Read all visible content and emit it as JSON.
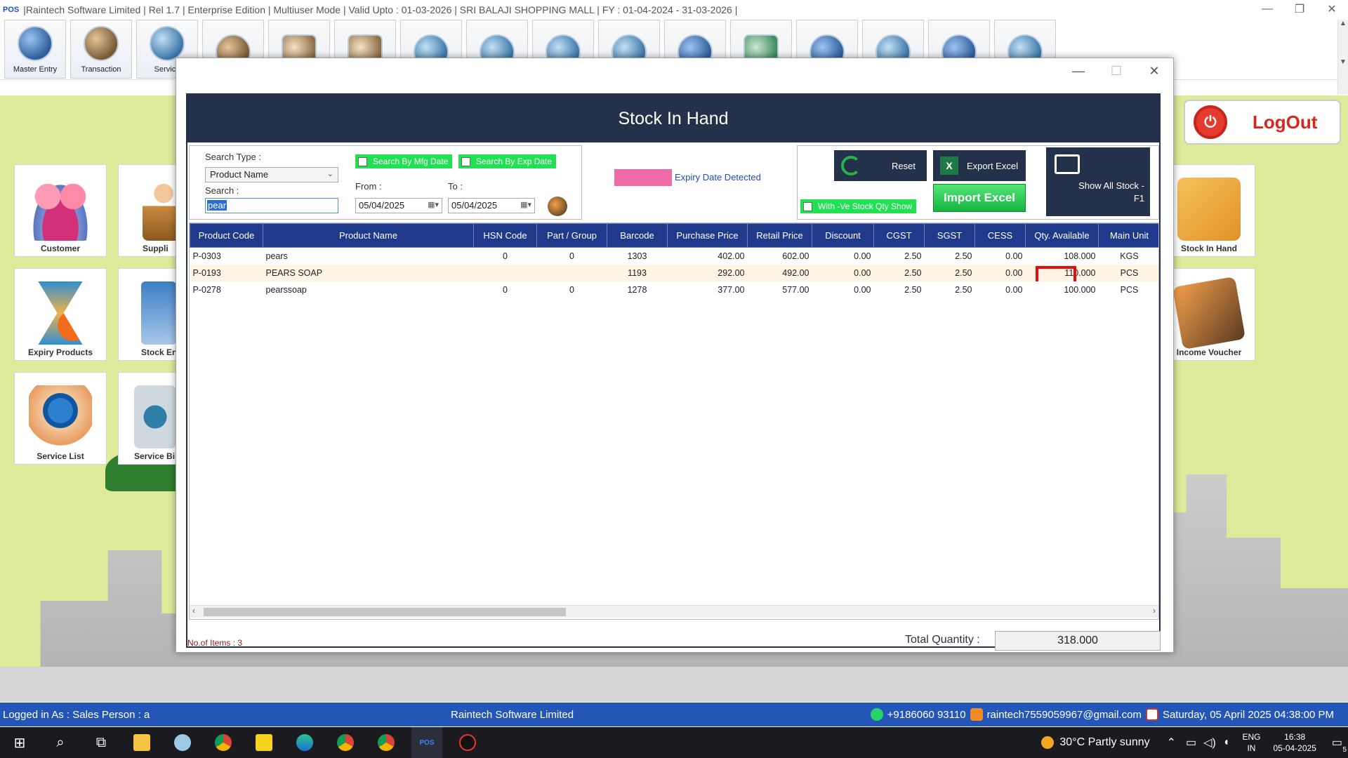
{
  "app": {
    "logo": "POS",
    "title": "|Raintech Software Limited |  Rel 1.7  |  Enterprise Edition  |  Multiuser Mode  |  Valid Upto : 01-03-2026  |  SRI BALAJI SHOPPING MALL  |  FY : 01-04-2024  -  31-03-2026  |",
    "win_minimize": "—",
    "win_restore": "❐",
    "win_close": "✕"
  },
  "toolbar": {
    "buttons": [
      {
        "label": "Master Entry",
        "icon": "master-entry-icon"
      },
      {
        "label": "Transaction",
        "icon": "transaction-icon"
      },
      {
        "label": "Service",
        "icon": "service-icon"
      }
    ]
  },
  "side": {
    "customer": "Customer",
    "supplier": "Suppli",
    "expiry_products": "Expiry Products",
    "stock_entry": "Stock En",
    "service_list": "Service List",
    "service_bill": "Service Bi",
    "stock_in_hand": "Stock In Hand",
    "income_voucher": "Income Voucher",
    "logout": "LogOut"
  },
  "modal": {
    "minimize": "—",
    "maximize": "☐",
    "close": "✕",
    "title": "Stock In Hand",
    "search_type_label": "Search Type :",
    "search_type_value": "Product Name",
    "search_label": "Search :",
    "search_value": "pear",
    "search_by_mfg": "Search By Mfg Date",
    "search_by_exp": "Search By Exp Date",
    "from_label": "From :",
    "to_label": "To :",
    "from_date": "05/04/2025",
    "to_date": "05/04/2025",
    "expiry_legend": "Expiry Date Detected",
    "expiry_color": "#f06aa8",
    "reset": "Reset",
    "export_excel": "Export Excel",
    "show_all_stock": "Show All Stock  -\nF1",
    "import_excel": "Import Excel",
    "neg_stock": "With -Ve Stock Qty Show",
    "no_of_items": "No.of Items : 3",
    "total_qty_label": "Total Quantity :",
    "total_qty_value": "318.000"
  },
  "table": {
    "headers": [
      "Product Code",
      "Product Name",
      "HSN Code",
      "Part / Group",
      "Barcode",
      "Purchase Price",
      "Retail Price",
      "Discount",
      "CGST",
      "SGST",
      "CESS",
      "Qty. Available",
      "Main Unit"
    ],
    "rows": [
      [
        "P-0303",
        "pears",
        "0",
        "0",
        "1303",
        "402.00",
        "602.00",
        "0.00",
        "2.50",
        "2.50",
        "0.00",
        "108.000",
        "KGS"
      ],
      [
        "P-0193",
        "PEARS SOAP",
        "",
        "",
        "1193",
        "292.00",
        "492.00",
        "0.00",
        "2.50",
        "2.50",
        "0.00",
        "110.000",
        "PCS"
      ],
      [
        "P-0278",
        "pearssoap",
        "0",
        "0",
        "1278",
        "377.00",
        "577.00",
        "0.00",
        "2.50",
        "2.50",
        "0.00",
        "100.000",
        "PCS"
      ]
    ]
  },
  "status": {
    "logged_in": "Logged in As :  Sales Person  :  a",
    "company": "Raintech Software Limited",
    "phone": "+9186060 93110",
    "email": "raintech7559059967@gmail.com",
    "datetime": "Saturday, 05 April 2025 04:38:00 PM"
  },
  "taskbar": {
    "weather": "30°C  Partly sunny",
    "lang1": "ENG",
    "lang2": "IN",
    "time": "16:38",
    "date": "05-04-2025",
    "notif_count": "5"
  }
}
